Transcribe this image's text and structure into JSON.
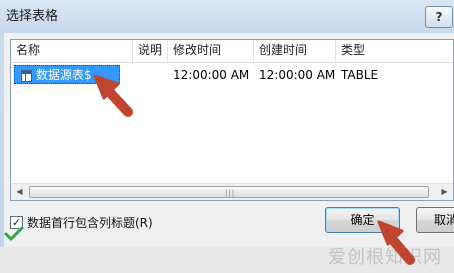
{
  "window": {
    "title": "选择表格",
    "help_label": "?"
  },
  "list": {
    "columns": [
      "名称",
      "说明",
      "修改时间",
      "创建时间",
      "类型"
    ],
    "rows": [
      {
        "name": "数据源表$",
        "description": "",
        "modified": "12:00:00 AM",
        "created": "12:00:00 AM",
        "type": "TABLE"
      }
    ]
  },
  "options": {
    "header_checkbox_label": "数据首行包含列标题(R)",
    "header_checkbox_checked": true
  },
  "buttons": {
    "ok": "确定",
    "cancel": "取消"
  },
  "watermark": "爱创根知识网",
  "colors": {
    "selection": "#3399ff",
    "annotation_arrow": "#c0452f",
    "check_mark": "#2aa84a"
  },
  "icons": [
    "table-icon",
    "scroll-left-icon",
    "scroll-right-icon",
    "checkmark-icon",
    "arrow-annotation-icon"
  ]
}
